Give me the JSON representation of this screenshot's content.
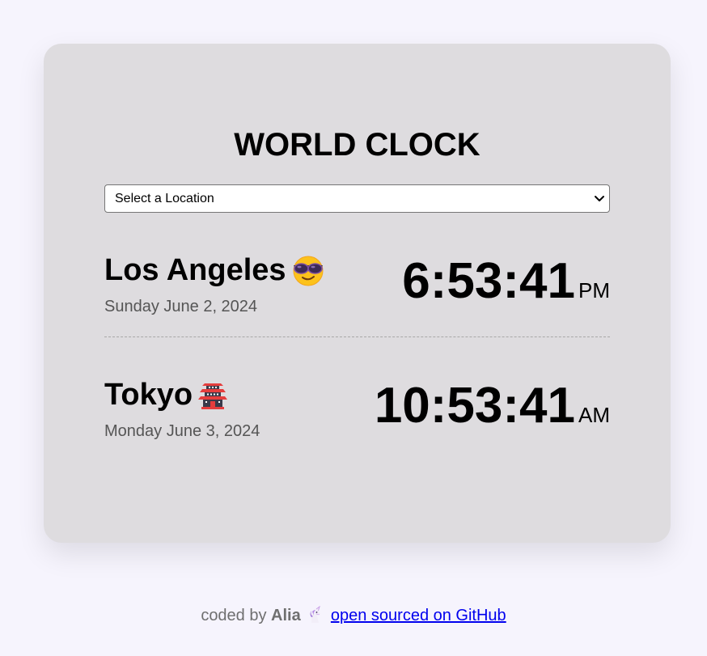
{
  "header": {
    "title": "WORLD CLOCK"
  },
  "location_select": {
    "selected": "Select a Location"
  },
  "cities": [
    {
      "name": "Los Angeles",
      "emoji": "smiling-face-with-sunglasses-icon",
      "date": "Sunday June 2, 2024",
      "time": "6:53:41",
      "ampm": "PM"
    },
    {
      "name": "Tokyo",
      "emoji": "japanese-castle-icon",
      "date": "Monday June 3, 2024",
      "time": "10:53:41",
      "ampm": "AM"
    }
  ],
  "footer": {
    "coded_by": "coded by",
    "author": "Alia",
    "author_icon": "unicorn-icon",
    "link_text": "open sourced on GitHub"
  },
  "colors": {
    "page_background": "#f6f4fd",
    "card_background": "#dedcdf",
    "link": "#0000ee"
  }
}
